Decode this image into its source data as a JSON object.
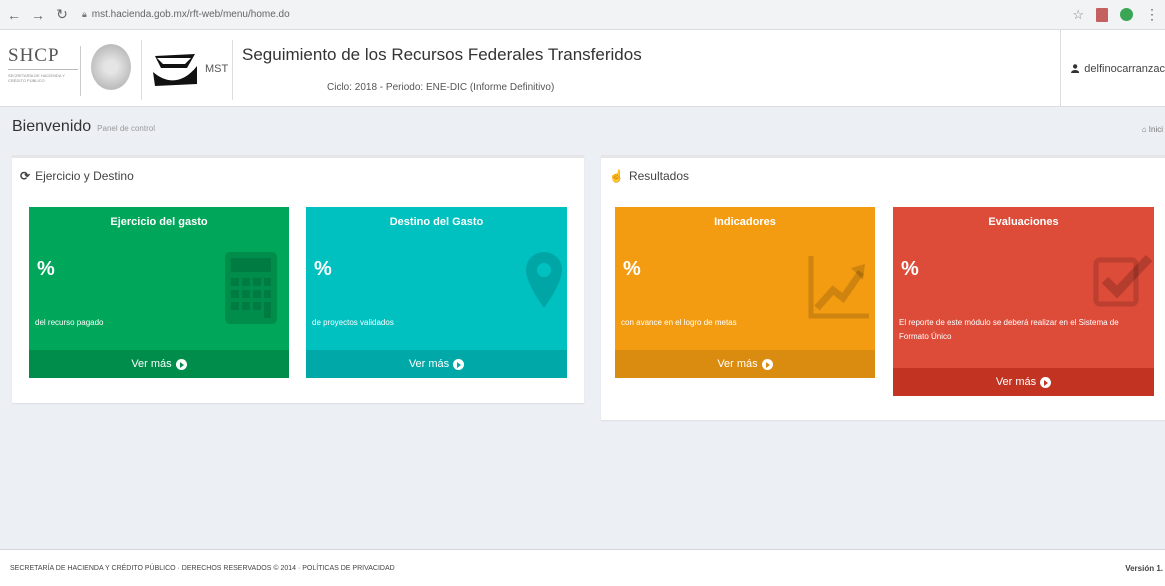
{
  "browser": {
    "url": "mst.hacienda.gob.mx/rft-web/menu/home.do"
  },
  "header": {
    "shcp_logo": "SHCP",
    "shcp_sub": "SECRETARÍA DE HACIENDA Y CRÉDITO PÚBLICO",
    "mst_label": "MST",
    "title": "Seguimiento de los Recursos Federales Transferidos",
    "subtitle": "Ciclo: 2018 - Periodo: ENE-DIC (Informe Definitivo)",
    "user": "delfinocarranzac"
  },
  "content_header": {
    "title": "Bienvenido",
    "subtitle": "Panel de control",
    "breadcrumb": "Inici"
  },
  "panels": {
    "left": {
      "title": "Ejercicio y Destino",
      "tiles": [
        {
          "title": "Ejercicio del gasto",
          "value": "%",
          "desc": "del recurso pagado",
          "link": "Ver más",
          "icon": "calculator-icon"
        },
        {
          "title": "Destino del Gasto",
          "value": "%",
          "desc": "de proyectos validados",
          "link": "Ver más",
          "icon": "map-marker-icon"
        }
      ]
    },
    "right": {
      "title": "Resultados",
      "tiles": [
        {
          "title": "Indicadores",
          "value": "%",
          "desc": "con avance en el logro de metas",
          "link": "Ver más",
          "icon": "line-chart-icon"
        },
        {
          "title": "Evaluaciones",
          "value": "%",
          "desc": "El reporte de este módulo se deberá realizar en el Sistema de Formato Único",
          "link": "Ver más",
          "icon": "check-square-icon"
        }
      ]
    }
  },
  "footer": {
    "text": "SECRETARÍA DE HACIENDA Y CRÉDITO PÚBLICO · DERECHOS RESERVADOS © 2014 · POLÍTICAS DE PRIVACIDAD",
    "version": "Versión 1."
  },
  "colors": {
    "green": "#00a65a",
    "teal": "#00c0c0",
    "orange": "#f39c12",
    "red": "#dd4b39"
  }
}
